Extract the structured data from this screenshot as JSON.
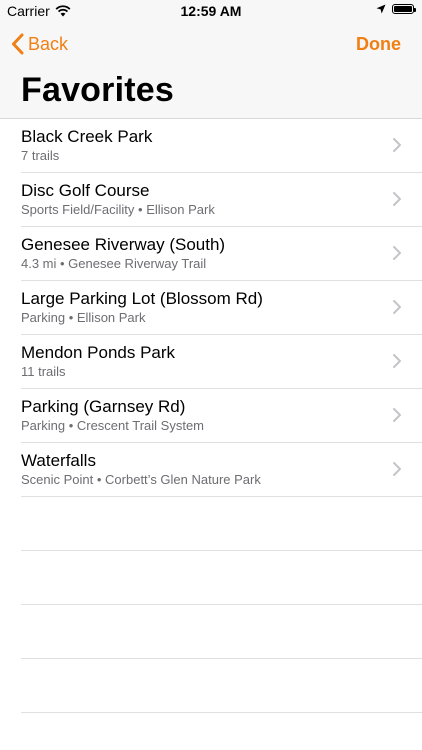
{
  "status_bar": {
    "carrier": "Carrier",
    "time": "12:59 AM"
  },
  "nav": {
    "back_label": "Back",
    "done_label": "Done",
    "title": "Favorites"
  },
  "items": [
    {
      "title": "Black Creek Park",
      "subtitle": "7 trails"
    },
    {
      "title": "Disc Golf Course",
      "subtitle": "Sports Field/Facility • Ellison Park"
    },
    {
      "title": "Genesee Riverway (South)",
      "subtitle": "4.3 mi • Genesee Riverway Trail"
    },
    {
      "title": "Large Parking Lot (Blossom Rd)",
      "subtitle": "Parking • Ellison Park"
    },
    {
      "title": "Mendon Ponds Park",
      "subtitle": "11 trails"
    },
    {
      "title": "Parking (Garnsey Rd)",
      "subtitle": "Parking • Crescent Trail System"
    },
    {
      "title": "Waterfalls",
      "subtitle": "Scenic Point • Corbett’s Glen Nature Park"
    }
  ],
  "icons": {
    "back": "chevron-left-icon",
    "row": "chevron-right-icon",
    "wifi": "wifi-icon",
    "location": "location-arrow-icon",
    "battery": "battery-icon"
  },
  "colors": {
    "accent": "#f07f14",
    "secondary_text": "#6d6d72",
    "bar_bg": "#f7f7f7",
    "separator": "#e0e0e0"
  }
}
